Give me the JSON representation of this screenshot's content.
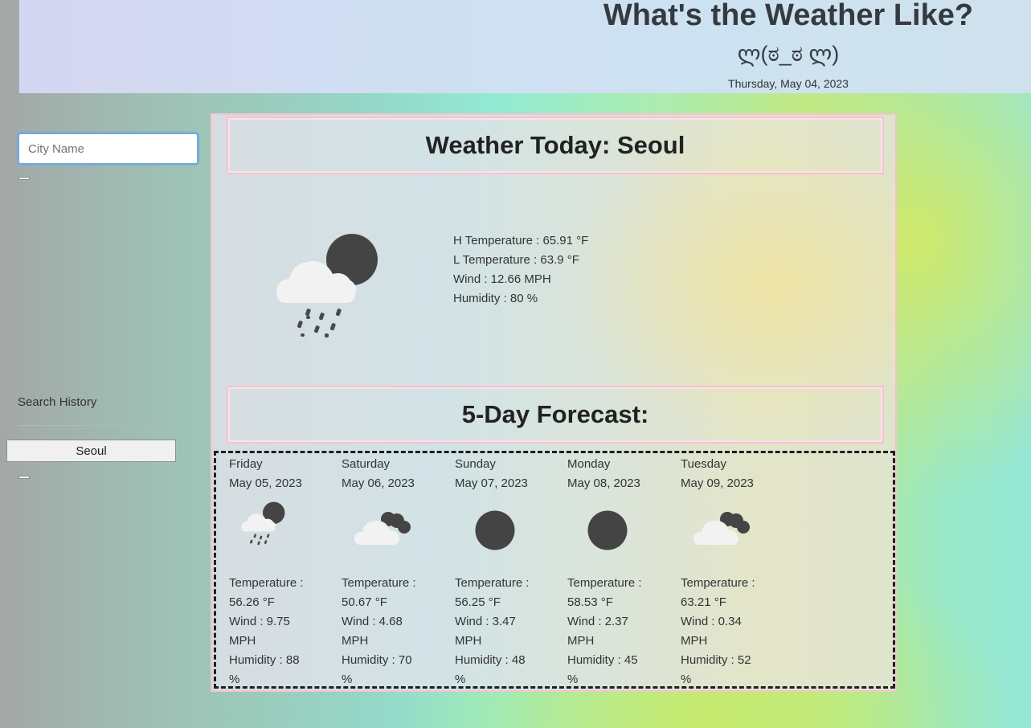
{
  "header": {
    "title": "What's the Weather Like?",
    "face": "ლ(ಠ_ಠ ლ)",
    "date": "Thursday, May 04, 2023"
  },
  "sidebar": {
    "search_placeholder": "City Name",
    "history_label": "Search History",
    "history_items": [
      "Seoul"
    ]
  },
  "today": {
    "heading": "Weather Today: Seoul",
    "icon": "night-cloud-rain-icon",
    "stats": [
      "H Temperature : 65.91 °F",
      "L Temperature : 63.9 °F",
      "Wind : 12.66 MPH",
      "Humidity : 80 %"
    ]
  },
  "forecast": {
    "heading": "5-Day Forecast:",
    "days": [
      {
        "day": "Friday",
        "date": "May 05, 2023",
        "icon": "night-cloud-rain-icon",
        "temp_label": "Temperature :",
        "temp": "56.26 °F",
        "wind_label": "Wind : 9.75",
        "wind_unit": "MPH",
        "humidity_label": "Humidity : 88",
        "humidity_unit": "%"
      },
      {
        "day": "Saturday",
        "date": "May 06, 2023",
        "icon": "night-broken-clouds-icon",
        "temp_label": "Temperature :",
        "temp": "50.67 °F",
        "wind_label": "Wind : 4.68",
        "wind_unit": "MPH",
        "humidity_label": "Humidity : 70",
        "humidity_unit": "%"
      },
      {
        "day": "Sunday",
        "date": "May 07, 2023",
        "icon": "moon-clear-icon",
        "temp_label": "Temperature :",
        "temp": "56.25 °F",
        "wind_label": "Wind : 3.47",
        "wind_unit": "MPH",
        "humidity_label": "Humidity : 48",
        "humidity_unit": "%"
      },
      {
        "day": "Monday",
        "date": "May 08, 2023",
        "icon": "moon-clear-icon",
        "temp_label": "Temperature :",
        "temp": "58.53 °F",
        "wind_label": "Wind : 2.37",
        "wind_unit": "MPH",
        "humidity_label": "Humidity : 45",
        "humidity_unit": "%"
      },
      {
        "day": "Tuesday",
        "date": "May 09, 2023",
        "icon": "night-broken-clouds-icon",
        "temp_label": "Temperature :",
        "temp": "63.21 °F",
        "wind_label": "Wind : 0.34",
        "wind_unit": "MPH",
        "humidity_label": "Humidity : 52",
        "humidity_unit": "%"
      }
    ]
  },
  "colors": {
    "accent_pink": "#f6c3cf",
    "heading_text": "#343a40",
    "icon_dark": "#444444",
    "cloud_white": "#f2f2f2"
  }
}
